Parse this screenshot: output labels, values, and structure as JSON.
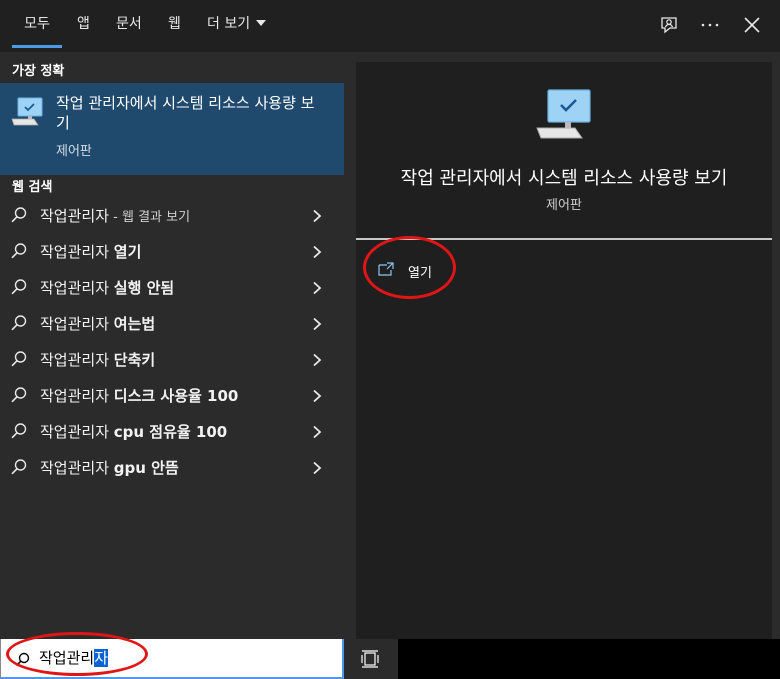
{
  "tabs": [
    {
      "label": "모두",
      "active": true
    },
    {
      "label": "앱"
    },
    {
      "label": "문서"
    },
    {
      "label": "웹"
    },
    {
      "label": "더 보기"
    }
  ],
  "left": {
    "best_match_label": "가장 정확",
    "best": {
      "title": "작업 관리자에서 시스템 리소스 사용량 보기",
      "subtitle": "제어판"
    },
    "web_label": "웹 검색",
    "web_items": [
      {
        "prefix": "작업관리자",
        "bold": "",
        "suffix": " - 웹 결과 보기"
      },
      {
        "prefix": "작업관리자 ",
        "bold": "열기",
        "suffix": ""
      },
      {
        "prefix": "작업관리자 ",
        "bold": "실행 안됨",
        "suffix": ""
      },
      {
        "prefix": "작업관리자 ",
        "bold": "여는법",
        "suffix": ""
      },
      {
        "prefix": "작업관리자 ",
        "bold": "단축키",
        "suffix": ""
      },
      {
        "prefix": "작업관리자 ",
        "bold": "디스크 사용율 100",
        "suffix": ""
      },
      {
        "prefix": "작업관리자 ",
        "bold": "cpu 점유율 100",
        "suffix": ""
      },
      {
        "prefix": "작업관리자 ",
        "bold": "gpu 안뜸",
        "suffix": ""
      }
    ]
  },
  "right": {
    "title": "작업 관리자에서 시스템 리소스 사용량 보기",
    "subtitle": "제어판",
    "action_label": "열기"
  },
  "search": {
    "query_plain": "작업관리",
    "query_selected": "자"
  },
  "colors": {
    "accent": "#4c9be8",
    "best_bg": "#1f4a6e",
    "annotation": "#e01616"
  }
}
